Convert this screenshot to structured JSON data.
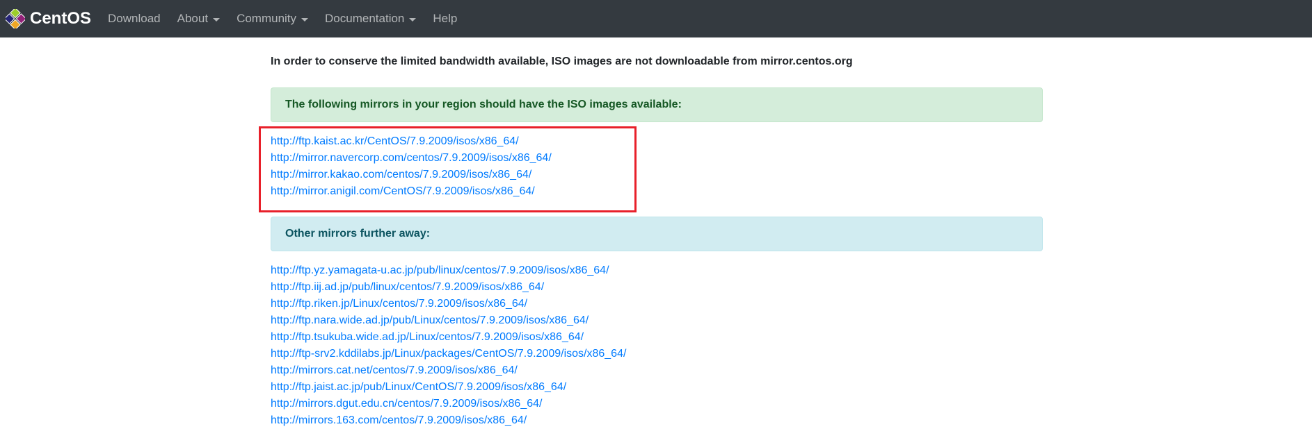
{
  "navbar": {
    "brand": "CentOS",
    "items": [
      {
        "label": "Download",
        "dropdown": false
      },
      {
        "label": "About",
        "dropdown": true
      },
      {
        "label": "Community",
        "dropdown": true
      },
      {
        "label": "Documentation",
        "dropdown": true
      },
      {
        "label": "Help",
        "dropdown": false
      }
    ]
  },
  "main": {
    "notice": "In order to conserve the limited bandwidth available, ISO images are not downloadable from mirror.centos.org",
    "region_alert": "The following mirrors in your region should have the ISO images available:",
    "region_mirrors": [
      "http://ftp.kaist.ac.kr/CentOS/7.9.2009/isos/x86_64/",
      "http://mirror.navercorp.com/centos/7.9.2009/isos/x86_64/",
      "http://mirror.kakao.com/centos/7.9.2009/isos/x86_64/",
      "http://mirror.anigil.com/CentOS/7.9.2009/isos/x86_64/"
    ],
    "other_alert": "Other mirrors further away:",
    "other_mirrors": [
      "http://ftp.yz.yamagata-u.ac.jp/pub/linux/centos/7.9.2009/isos/x86_64/",
      "http://ftp.iij.ad.jp/pub/linux/centos/7.9.2009/isos/x86_64/",
      "http://ftp.riken.jp/Linux/centos/7.9.2009/isos/x86_64/",
      "http://ftp.nara.wide.ad.jp/pub/Linux/centos/7.9.2009/isos/x86_64/",
      "http://ftp.tsukuba.wide.ad.jp/Linux/centos/7.9.2009/isos/x86_64/",
      "http://ftp-srv2.kddilabs.jp/Linux/packages/CentOS/7.9.2009/isos/x86_64/",
      "http://mirrors.cat.net/centos/7.9.2009/isos/x86_64/",
      "http://ftp.jaist.ac.jp/pub/Linux/CentOS/7.9.2009/isos/x86_64/",
      "http://mirrors.dgut.edu.cn/centos/7.9.2009/isos/x86_64/",
      "http://mirrors.163.com/centos/7.9.2009/isos/x86_64/"
    ]
  },
  "colors": {
    "navbar": "#343a40",
    "link": "#007bff",
    "highlight": "#e8202a"
  },
  "icons": {
    "logo": "centos-logo-icon",
    "caret": "chevron-down-icon"
  }
}
